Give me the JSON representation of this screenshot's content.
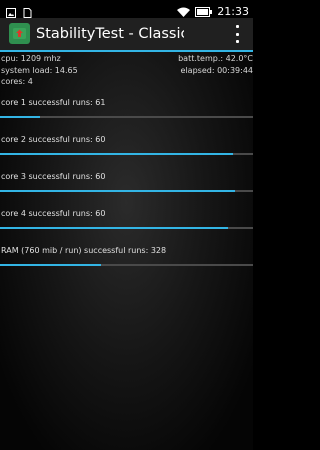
{
  "status_bar": {
    "time": "21:33",
    "icons": [
      "wifi-icon",
      "battery-icon",
      "notification-image-icon",
      "notification-file-icon"
    ]
  },
  "action_bar": {
    "title": "StabilityTest - Classic Test",
    "icon": "app-icon",
    "overflow_icon": "overflow-menu-icon"
  },
  "info": {
    "cpu": "cpu: 1209 mhz",
    "system_load": "system load: 14.65",
    "cores": "cores: 4",
    "batt_temp": "batt.temp.: 42.0°C",
    "elapsed": "elapsed: 00:39:44"
  },
  "runs": [
    {
      "label": "core 1 successful runs: 61",
      "progress": 0.16
    },
    {
      "label": "core 2 successful runs: 60",
      "progress": 0.92
    },
    {
      "label": "core 3 successful runs: 60",
      "progress": 0.93
    },
    {
      "label": "core 4 successful runs: 60",
      "progress": 0.9
    },
    {
      "label": "RAM (760 mib / run) successful runs: 328",
      "progress": 0.4
    }
  ],
  "colors": {
    "accent": "#33b5e5",
    "track": "#4a4a4a",
    "action_bar": "#202020",
    "app_icon": "#2f8f4f"
  }
}
